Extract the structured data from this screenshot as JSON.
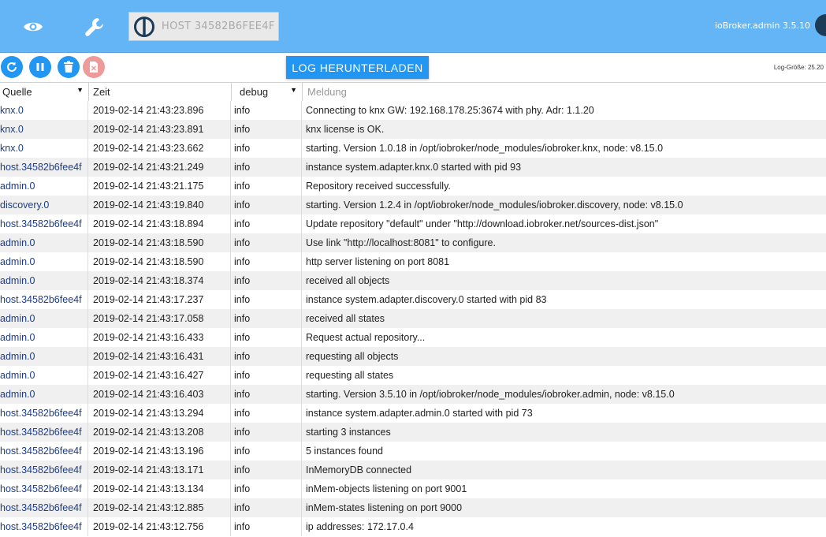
{
  "header": {
    "nav": [
      {
        "name": "eye-icon"
      },
      {
        "name": "wrench-icon"
      }
    ],
    "host_label": "HOST 34582B6FEE4F",
    "app_version": "ioBroker.admin 3.5.10",
    "colors": {
      "bar": "#64b5f6",
      "accent": "#2196f3"
    }
  },
  "toolbar": {
    "buttons": [
      {
        "name": "refresh-icon"
      },
      {
        "name": "pause-icon"
      },
      {
        "name": "trash-icon"
      },
      {
        "name": "delete-log-icon"
      }
    ],
    "download_label": "LOG HERUNTERLADEN",
    "log_size": "Log-Größe: 25.20"
  },
  "table": {
    "columns": [
      "Quelle",
      "Zeit",
      "debug",
      "Meldung"
    ],
    "rows": [
      {
        "source": "knx.0",
        "time": "2019-02-14 21:43:23.896",
        "severity": "info",
        "message": "Connecting to knx GW: 192.168.178.25:3674 with phy. Adr: 1.1.20"
      },
      {
        "source": "knx.0",
        "time": "2019-02-14 21:43:23.891",
        "severity": "info",
        "message": "knx license is OK."
      },
      {
        "source": "knx.0",
        "time": "2019-02-14 21:43:23.662",
        "severity": "info",
        "message": "starting. Version 1.0.18 in /opt/iobroker/node_modules/iobroker.knx, node: v8.15.0"
      },
      {
        "source": "host.34582b6fee4f",
        "time": "2019-02-14 21:43:21.249",
        "severity": "info",
        "message": "instance system.adapter.knx.0 started with pid 93"
      },
      {
        "source": "admin.0",
        "time": "2019-02-14 21:43:21.175",
        "severity": "info",
        "message": "Repository received successfully."
      },
      {
        "source": "discovery.0",
        "time": "2019-02-14 21:43:19.840",
        "severity": "info",
        "message": "starting. Version 1.2.4 in /opt/iobroker/node_modules/iobroker.discovery, node: v8.15.0"
      },
      {
        "source": "host.34582b6fee4f",
        "time": "2019-02-14 21:43:18.894",
        "severity": "info",
        "message": "Update repository \"default\" under \"http://download.iobroker.net/sources-dist.json\""
      },
      {
        "source": "admin.0",
        "time": "2019-02-14 21:43:18.590",
        "severity": "info",
        "message": "Use link \"http://localhost:8081\" to configure."
      },
      {
        "source": "admin.0",
        "time": "2019-02-14 21:43:18.590",
        "severity": "info",
        "message": "http server listening on port 8081"
      },
      {
        "source": "admin.0",
        "time": "2019-02-14 21:43:18.374",
        "severity": "info",
        "message": "received all objects"
      },
      {
        "source": "host.34582b6fee4f",
        "time": "2019-02-14 21:43:17.237",
        "severity": "info",
        "message": "instance system.adapter.discovery.0 started with pid 83"
      },
      {
        "source": "admin.0",
        "time": "2019-02-14 21:43:17.058",
        "severity": "info",
        "message": "received all states"
      },
      {
        "source": "admin.0",
        "time": "2019-02-14 21:43:16.433",
        "severity": "info",
        "message": "Request actual repository..."
      },
      {
        "source": "admin.0",
        "time": "2019-02-14 21:43:16.431",
        "severity": "info",
        "message": "requesting all objects"
      },
      {
        "source": "admin.0",
        "time": "2019-02-14 21:43:16.427",
        "severity": "info",
        "message": "requesting all states"
      },
      {
        "source": "admin.0",
        "time": "2019-02-14 21:43:16.403",
        "severity": "info",
        "message": "starting. Version 3.5.10 in /opt/iobroker/node_modules/iobroker.admin, node: v8.15.0"
      },
      {
        "source": "host.34582b6fee4f",
        "time": "2019-02-14 21:43:13.294",
        "severity": "info",
        "message": "instance system.adapter.admin.0 started with pid 73"
      },
      {
        "source": "host.34582b6fee4f",
        "time": "2019-02-14 21:43:13.208",
        "severity": "info",
        "message": "starting 3 instances"
      },
      {
        "source": "host.34582b6fee4f",
        "time": "2019-02-14 21:43:13.196",
        "severity": "info",
        "message": "5 instances found"
      },
      {
        "source": "host.34582b6fee4f",
        "time": "2019-02-14 21:43:13.171",
        "severity": "info",
        "message": "InMemoryDB connected"
      },
      {
        "source": "host.34582b6fee4f",
        "time": "2019-02-14 21:43:13.134",
        "severity": "info",
        "message": "inMem-objects listening on port 9001"
      },
      {
        "source": "host.34582b6fee4f",
        "time": "2019-02-14 21:43:12.885",
        "severity": "info",
        "message": "inMem-states listening on port 9000"
      },
      {
        "source": "host.34582b6fee4f",
        "time": "2019-02-14 21:43:12.756",
        "severity": "info",
        "message": "ip addresses: 172.17.0.4"
      }
    ]
  }
}
